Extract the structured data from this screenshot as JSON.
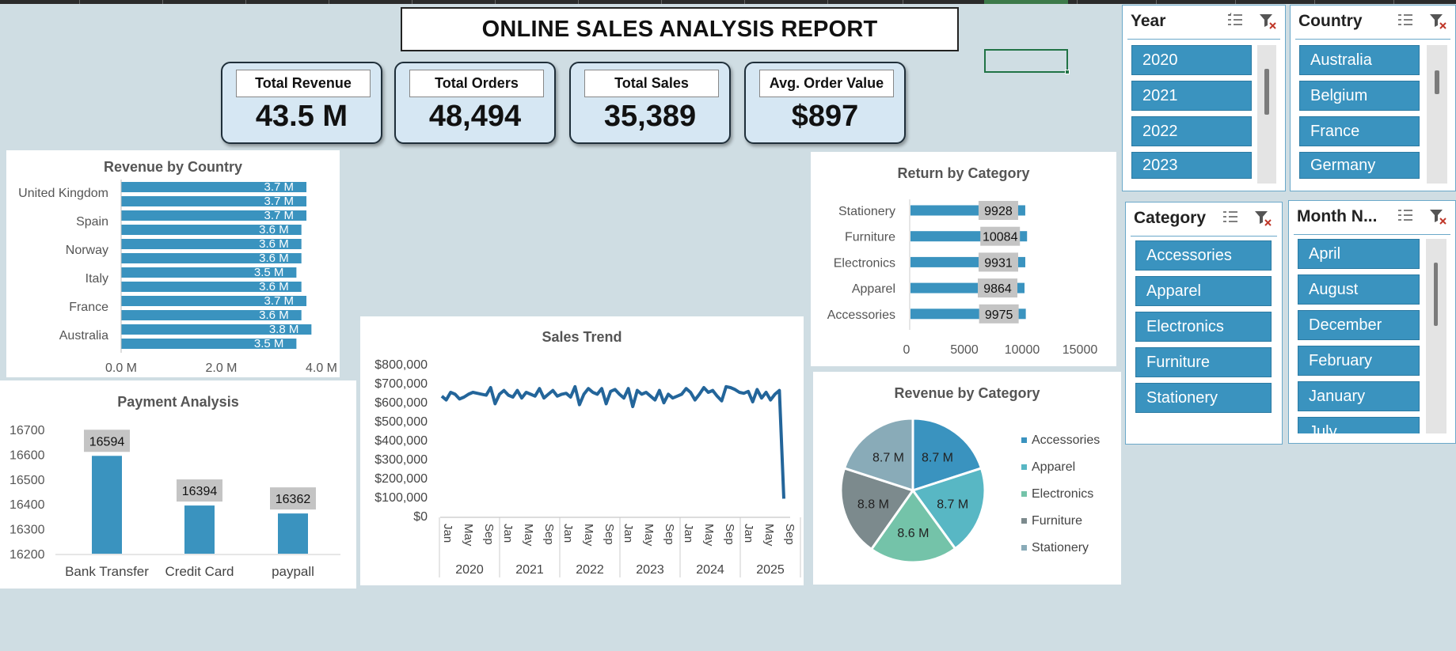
{
  "report_title": "ONLINE SALES ANALYSIS REPORT",
  "kpis": [
    {
      "label": "Total Revenue",
      "value": "43.5 M"
    },
    {
      "label": "Total Orders",
      "value": "48,494"
    },
    {
      "label": "Total Sales",
      "value": "35,389"
    },
    {
      "label": "Avg. Order Value",
      "value": "$897"
    }
  ],
  "chart_data": [
    {
      "id": "revenue_by_country",
      "type": "bar",
      "orientation": "horizontal",
      "title": "Revenue by Country",
      "categories_visible_labels": [
        "United Kingdom",
        "Spain",
        "Norway",
        "Italy",
        "France",
        "Australia"
      ],
      "values": [
        3.7,
        3.7,
        3.7,
        3.6,
        3.6,
        3.6,
        3.5,
        3.6,
        3.7,
        3.6,
        3.8,
        3.5
      ],
      "value_labels": [
        "3.7 M",
        "3.7 M",
        "3.7 M",
        "3.6 M",
        "3.6 M",
        "3.6 M",
        "3.5 M",
        "3.6 M",
        "3.7 M",
        "3.6 M",
        "3.8 M",
        "3.5 M"
      ],
      "xticks": [
        "0.0 M",
        "2.0 M",
        "4.0 M"
      ],
      "xlim": [
        0,
        4.0
      ],
      "color": "#3a93bf"
    },
    {
      "id": "return_by_category",
      "type": "bar",
      "orientation": "horizontal",
      "title": "Return by Category",
      "categories": [
        "Stationery",
        "Furniture",
        "Electronics",
        "Apparel",
        "Accessories"
      ],
      "values": [
        9928,
        10084,
        9931,
        9864,
        9975
      ],
      "xticks": [
        "0",
        "5000",
        "10000",
        "15000"
      ],
      "xlim": [
        0,
        15000
      ],
      "color": "#3a93bf"
    },
    {
      "id": "payment_analysis",
      "type": "bar",
      "title": "Payment Analysis",
      "categories": [
        "Bank Transfer",
        "Credit Card",
        "paypall"
      ],
      "values": [
        16594,
        16394,
        16362
      ],
      "yticks": [
        "16700",
        "16600",
        "16500",
        "16400",
        "16300",
        "16200"
      ],
      "ylim": [
        16200,
        16700
      ],
      "color": "#3a93bf"
    },
    {
      "id": "sales_trend",
      "type": "line",
      "title": "Sales Trend",
      "yticks": [
        "$800,000",
        "$700,000",
        "$600,000",
        "$500,000",
        "$400,000",
        "$300,000",
        "$200,000",
        "$100,000",
        "$0"
      ],
      "ylim": [
        0,
        800000
      ],
      "years": [
        "2020",
        "2021",
        "2022",
        "2023",
        "2024",
        "2025"
      ],
      "month_ticks": [
        "Jan",
        "May",
        "Sep"
      ],
      "values": [
        630000,
        610000,
        650000,
        640000,
        615000,
        625000,
        640000,
        650000,
        645000,
        640000,
        635000,
        675000,
        590000,
        640000,
        660000,
        635000,
        625000,
        660000,
        620000,
        650000,
        640000,
        630000,
        670000,
        620000,
        640000,
        660000,
        630000,
        640000,
        645000,
        625000,
        680000,
        585000,
        640000,
        670000,
        650000,
        640000,
        670000,
        590000,
        655000,
        665000,
        640000,
        620000,
        670000,
        575000,
        660000,
        640000,
        650000,
        630000,
        610000,
        660000,
        595000,
        640000,
        620000,
        630000,
        640000,
        670000,
        650000,
        610000,
        640000,
        675000,
        650000,
        660000,
        630000,
        605000,
        680000,
        675000,
        665000,
        650000,
        645000,
        655000,
        600000,
        665000,
        620000,
        650000,
        610000,
        640000,
        660000,
        90000
      ],
      "color": "#23659a"
    },
    {
      "id": "revenue_by_category",
      "type": "pie",
      "title": "Revenue by Category",
      "categories": [
        "Accessories",
        "Apparel",
        "Electronics",
        "Furniture",
        "Stationery"
      ],
      "values": [
        8.7,
        8.7,
        8.6,
        8.8,
        8.7
      ],
      "value_labels": [
        "8.7 M",
        "8.7 M",
        "8.6 M",
        "8.8 M",
        "8.7 M"
      ],
      "colors": [
        "#3a93bf",
        "#58b7c4",
        "#74c3a9",
        "#7c8a8d",
        "#89abb8"
      ],
      "legend_position": "right"
    }
  ],
  "slicers": {
    "year": {
      "title": "Year",
      "items": [
        "2020",
        "2021",
        "2022",
        "2023"
      ]
    },
    "country": {
      "title": "Country",
      "items": [
        "Australia",
        "Belgium",
        "France",
        "Germany"
      ]
    },
    "category": {
      "title": "Category",
      "items": [
        "Accessories",
        "Apparel",
        "Electronics",
        "Furniture",
        "Stationery"
      ]
    },
    "month": {
      "title": "Month N...",
      "items": [
        "April",
        "August",
        "December",
        "February",
        "January",
        "July"
      ]
    }
  }
}
